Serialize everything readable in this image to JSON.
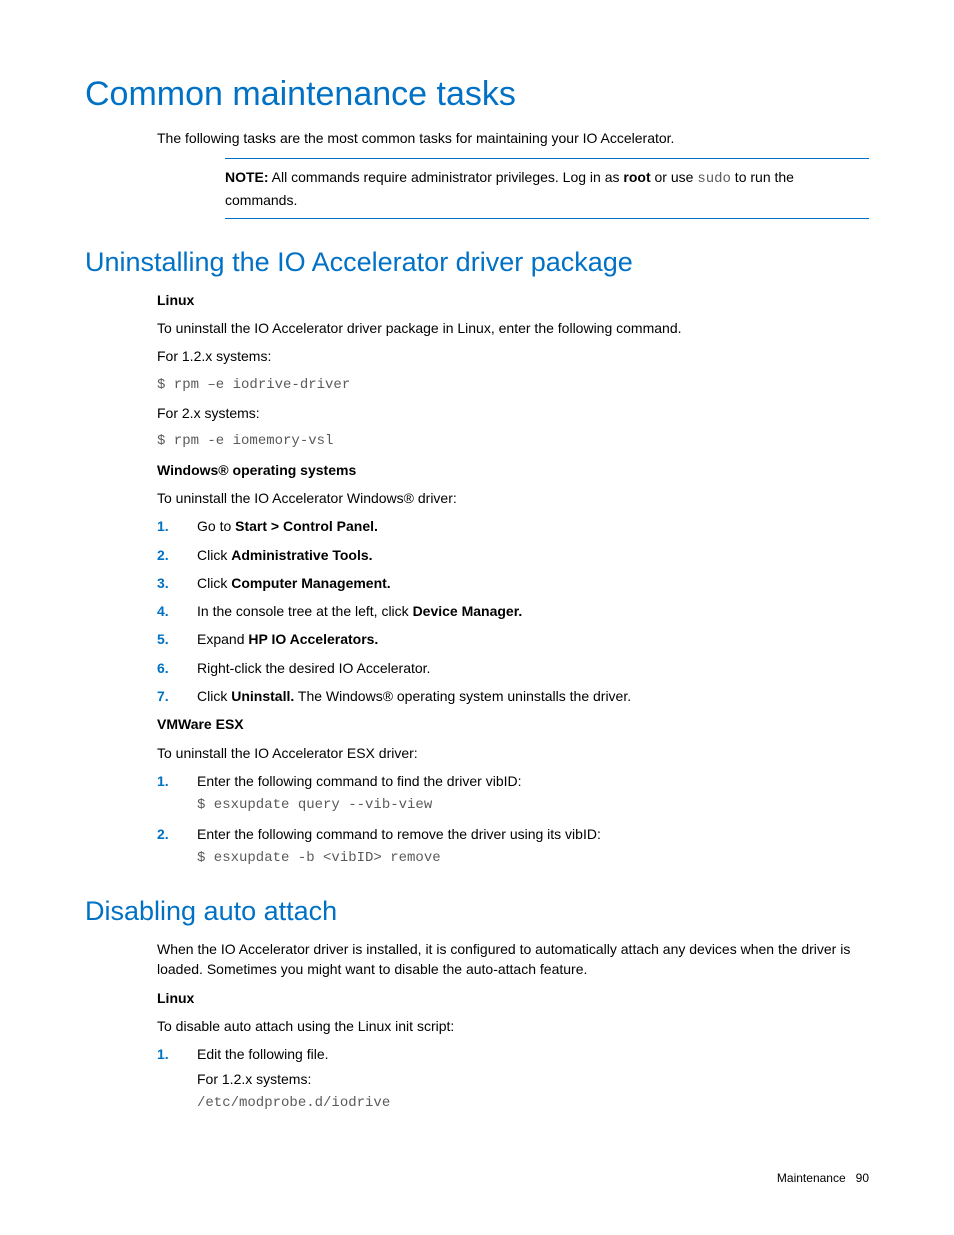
{
  "h1": "Common maintenance tasks",
  "intro": "The following tasks are the most common tasks for maintaining your IO Accelerator.",
  "note": {
    "label": "NOTE:",
    "pre": " All commands require administrator privileges. Log in as ",
    "bold": "root",
    "mid": " or use ",
    "code": "sudo",
    "post": " to run the commands."
  },
  "h2_uninstall": "Uninstalling the IO Accelerator driver package",
  "linux": {
    "title": "Linux",
    "intro": "To uninstall the IO Accelerator driver package in Linux, enter the following command.",
    "for12": "For 1.2.x systems:",
    "cmd12": "$ rpm –e iodrive-driver",
    "for2": "For 2.x systems:",
    "cmd2": "$ rpm -e iomemory-vsl"
  },
  "win": {
    "title": "Windows® operating systems",
    "intro": "To uninstall the IO Accelerator Windows® driver:",
    "steps": [
      {
        "pre": "Go to ",
        "bold": "Start > Control Panel."
      },
      {
        "pre": "Click ",
        "bold": "Administrative Tools."
      },
      {
        "pre": "Click ",
        "bold": "Computer Management."
      },
      {
        "pre": "In the console tree at the left, click ",
        "bold": "Device Manager."
      },
      {
        "pre": "Expand ",
        "bold": "HP IO Accelerators."
      },
      {
        "full": "Right-click the desired IO Accelerator."
      },
      {
        "pre": "Click ",
        "bold": "Uninstall.",
        "post": " The Windows® operating system uninstalls the driver."
      }
    ]
  },
  "esx": {
    "title": "VMWare ESX",
    "intro": "To uninstall the IO Accelerator ESX driver:",
    "steps": [
      {
        "text": "Enter the following command to find the driver vibID:",
        "cmd": "$ esxupdate query --vib-view"
      },
      {
        "text": "Enter the following command to remove the driver using its vibID:",
        "cmd": "$ esxupdate -b <vibID> remove"
      }
    ]
  },
  "h2_disable": "Disabling auto attach",
  "disable": {
    "intro": "When the IO Accelerator driver is installed, it is configured to automatically attach any devices when the driver is loaded. Sometimes you might want to disable the auto-attach feature.",
    "linux_title": "Linux",
    "linux_intro": "To disable auto attach using the Linux init script:",
    "step1": "Edit the following file.",
    "for12": "For 1.2.x systems:",
    "cmd": "/etc/modprobe.d/iodrive"
  },
  "footer": {
    "section": "Maintenance",
    "page": "90"
  }
}
